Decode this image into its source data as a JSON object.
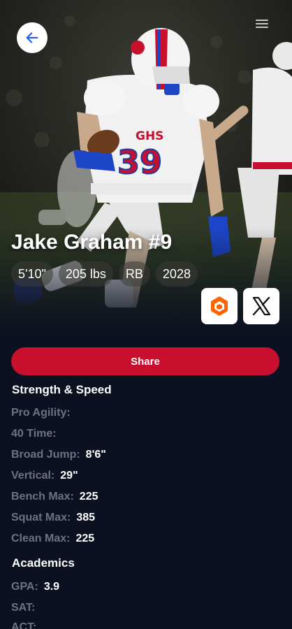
{
  "player": {
    "name": "Jake Graham #9",
    "chips": [
      "5'10\"",
      "205 lbs",
      "RB",
      "2028"
    ]
  },
  "jersey": {
    "school": "GHS",
    "number": "39"
  },
  "share_label": "Share",
  "strength": {
    "title": "Strength & Speed",
    "stats": [
      {
        "label": "Pro Agility:",
        "value": ""
      },
      {
        "label": "40 Time:",
        "value": ""
      },
      {
        "label": "Broad Jump:",
        "value": "8'6\""
      },
      {
        "label": "Vertical:",
        "value": "29\""
      },
      {
        "label": "Bench Max:",
        "value": "225"
      },
      {
        "label": "Squat Max:",
        "value": "385"
      },
      {
        "label": "Clean Max:",
        "value": "225"
      }
    ]
  },
  "academics": {
    "title": "Academics",
    "stats": [
      {
        "label": "GPA:",
        "value": "3.9"
      },
      {
        "label": "SAT:",
        "value": ""
      },
      {
        "label": "ACT:",
        "value": ""
      }
    ]
  },
  "colors": {
    "accent": "#c8102e",
    "background": "#0b1120",
    "label": "#6b7280",
    "back_arrow": "#2563eb",
    "hudl": "#ff6300"
  }
}
